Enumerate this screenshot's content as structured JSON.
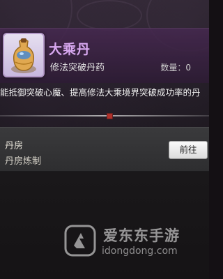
{
  "item": {
    "name": "大乘丹",
    "subtitle": "修法突破丹药",
    "quantity_label": "数量：0",
    "quantity": 0,
    "icon": "gourd-pill-icon",
    "description": "能抵御突破心魔、提高修法大乘境界突破成功率的丹"
  },
  "source": {
    "title": "丹房",
    "detail": "丹房炼制",
    "button_label": "前往"
  },
  "watermark": {
    "brand": "爱东东手游",
    "domain": "idongdong.com"
  },
  "colors": {
    "title": "#d8a8f0",
    "header_bg": "#46284f",
    "divider_gem": "#b0302a"
  }
}
